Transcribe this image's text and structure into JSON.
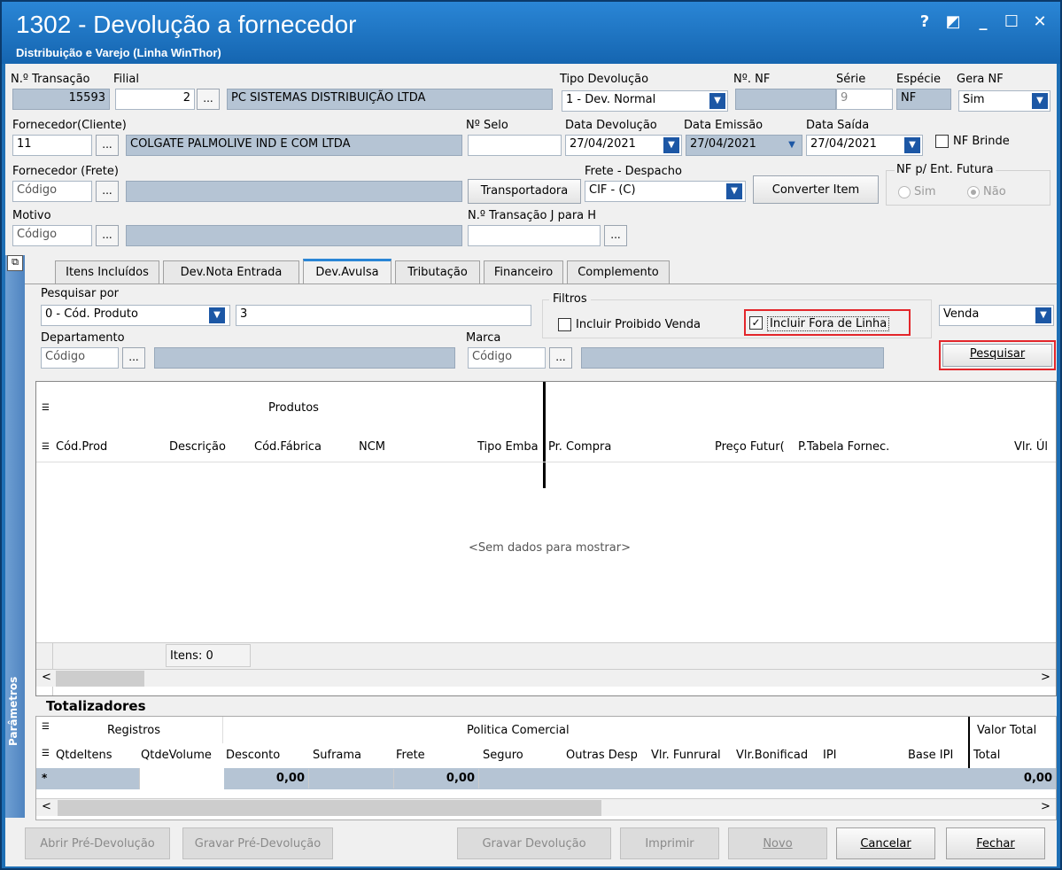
{
  "window": {
    "title": "1302 - Devolução a fornecedor",
    "subtitle": "Distribuição e Varejo (Linha WinThor)",
    "buttons": [
      "?",
      "◩",
      "_",
      "☐",
      "✕"
    ]
  },
  "header": {
    "transacao": {
      "label": "N.º Transação",
      "value": "15593"
    },
    "filial": {
      "label": "Filial",
      "value": "2",
      "name": "PC SISTEMAS DISTRIBUIÇÃO LTDA"
    },
    "tipo_devolucao": {
      "label": "Tipo Devolução",
      "value": "1 - Dev. Normal"
    },
    "nf": {
      "label": "Nº. NF",
      "value": ""
    },
    "serie": {
      "label": "Série",
      "value": "9"
    },
    "especie": {
      "label": "Espécie",
      "value": "NF"
    },
    "gera_nf": {
      "label": "Gera NF",
      "value": "Sim"
    },
    "fornecedor_cliente": {
      "label": "Fornecedor(Cliente)",
      "value": "11",
      "name": "COLGATE PALMOLIVE IND E COM LTDA"
    },
    "selo": {
      "label": "Nº Selo",
      "value": ""
    },
    "data_devolucao": {
      "label": "Data Devolução",
      "value": "27/04/2021"
    },
    "data_emissao": {
      "label": "Data Emissão",
      "value": "27/04/2021"
    },
    "data_saida": {
      "label": "Data Saída",
      "value": "27/04/2021"
    },
    "nf_brinde": {
      "label": "NF Brinde"
    },
    "fornecedor_frete": {
      "label": "Fornecedor (Frete)",
      "placeholder": "Código"
    },
    "transportadora_button": "Transportadora",
    "frete_despacho": {
      "label": "Frete - Despacho",
      "value": "CIF - (C)"
    },
    "converter_item_button": "Converter Item",
    "nf_futura": {
      "label": "NF p/ Ent. Futura",
      "sim": "Sim",
      "nao": "Não"
    },
    "motivo": {
      "label": "Motivo",
      "placeholder": "Código"
    },
    "transacao_j": {
      "label": "N.º Transação J para H",
      "value": ""
    },
    "dots": "..."
  },
  "tabs": [
    "Itens Incluídos",
    "Dev.Nota Entrada",
    "Dev.Avulsa",
    "Tributação",
    "Financeiro",
    "Complemento"
  ],
  "search": {
    "pesquisar_por_label": "Pesquisar por",
    "pesquisar_por_value": "0 - Cód. Produto",
    "search_value": "3",
    "filtros_label": "Filtros",
    "proibido_venda": "Incluir Proibido Venda",
    "fora_linha": "Incluir Fora de Linha",
    "venda_value": "Venda",
    "departamento_label": "Departamento",
    "marca_label": "Marca",
    "placeholder": "Código",
    "pesquisar_button": "Pesquisar"
  },
  "products_grid": {
    "band_label": "Produtos",
    "columns": [
      "Cód.Prod",
      "Descrição",
      "Cód.Fábrica",
      "NCM",
      "Tipo Emba",
      "Pr. Compra",
      "Preço Futur(",
      "P.Tabela Fornec.",
      "Vlr. Úl"
    ],
    "empty_text": "<Sem dados para mostrar>",
    "footer_text": "Itens: 0"
  },
  "totals": {
    "title": "Totalizadores",
    "band_registros": "Registros",
    "band_politica": "Politica Comercial",
    "band_valor": "Valor Total",
    "columns": [
      "QtdeItens",
      "QtdeVolume",
      "Desconto",
      "Suframa",
      "Frete",
      "Seguro",
      "Outras Desp",
      "Vlr. Funrural",
      "Vlr.Bonificad",
      "IPI",
      "Base IPI",
      "Total"
    ],
    "row": {
      "marker": "*",
      "desconto": "0,00",
      "frete": "0,00",
      "total": "0,00"
    }
  },
  "sidebar_label": "Parâmetros",
  "footer_buttons": [
    "Abrir Pré-Devolução",
    "Gravar Pré-Devolução",
    "Gravar Devolução",
    "Imprimir",
    "Novo",
    "Cancelar",
    "Fechar"
  ]
}
